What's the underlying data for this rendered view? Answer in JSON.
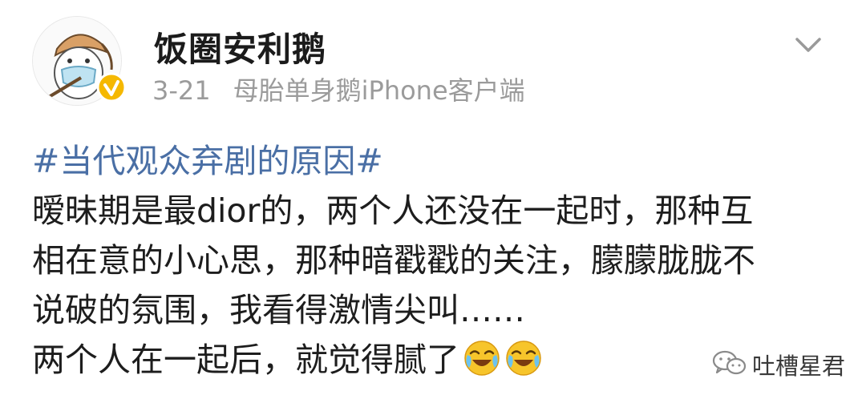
{
  "post": {
    "author": "饭圈安利鹅",
    "date": "3-21",
    "source": "母胎单身鹅iPhone客户端",
    "hashtag": "#当代观众弃剧的原因#",
    "lines": [
      "暧昧期是最dior的，两个人还没在一起时，那种互",
      "相在意的小心思，那种暗戳戳的关注，朦朦胧胧不",
      "说破的氛围，我看得激情尖叫……",
      "两个人在一起后，就觉得腻了"
    ],
    "emojis": [
      "laughing-crying-emoji",
      "laughing-crying-emoji"
    ],
    "more_icon": "chevron-down-icon",
    "verified_icon": "verified-badge-icon"
  },
  "watermark": {
    "icon": "wechat-icon",
    "label": "吐槽星君"
  },
  "colors": {
    "hashtag": "#4a6fa5",
    "meta": "#9b9b9b",
    "verified": "#f5b800",
    "emoji": "#f7c52b"
  }
}
